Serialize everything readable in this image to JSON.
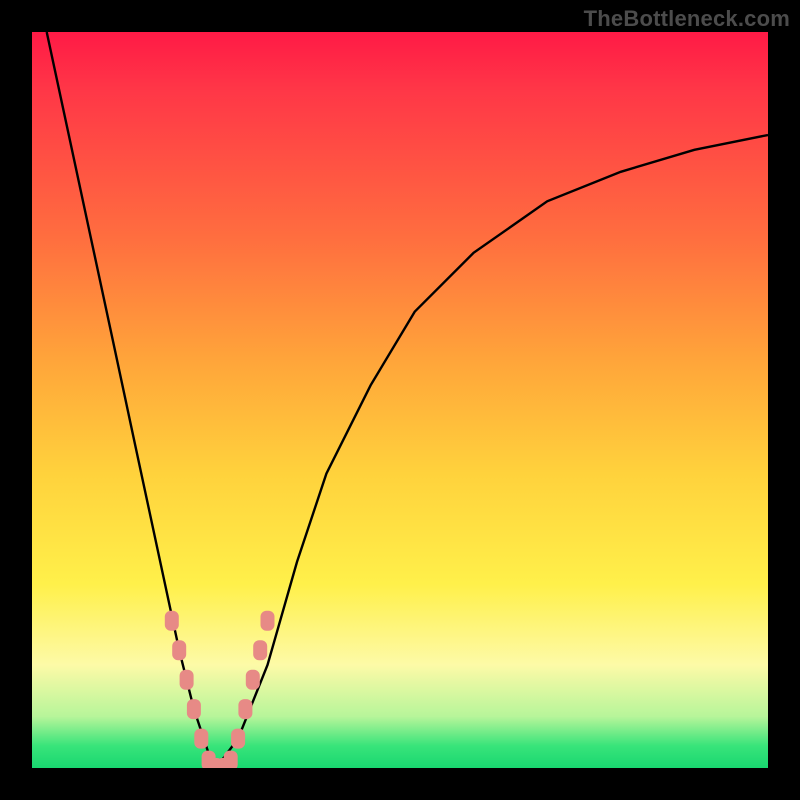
{
  "watermark": "TheBottleneck.com",
  "chart_data": {
    "type": "line",
    "title": "",
    "xlabel": "",
    "ylabel": "",
    "xlim": [
      0,
      100
    ],
    "ylim": [
      0,
      100
    ],
    "legend": false,
    "grid": false,
    "annotations": [],
    "series": [
      {
        "name": "bottleneck-curve",
        "color": "#000000",
        "x": [
          2,
          5,
          8,
          11,
          14,
          17,
          20,
          22,
          24,
          25,
          28,
          32,
          36,
          40,
          46,
          52,
          60,
          70,
          80,
          90,
          100
        ],
        "y": [
          100,
          86,
          72,
          58,
          44,
          30,
          16,
          8,
          2,
          0,
          4,
          14,
          28,
          40,
          52,
          62,
          70,
          77,
          81,
          84,
          86
        ]
      }
    ],
    "markers": [
      {
        "name": "curve-markers",
        "color": "#e78a86",
        "shape": "rounded-rect",
        "points": [
          {
            "x": 19,
            "y": 20
          },
          {
            "x": 20,
            "y": 16
          },
          {
            "x": 21,
            "y": 12
          },
          {
            "x": 22,
            "y": 8
          },
          {
            "x": 23,
            "y": 4
          },
          {
            "x": 24,
            "y": 1
          },
          {
            "x": 25,
            "y": 0
          },
          {
            "x": 26,
            "y": 0
          },
          {
            "x": 27,
            "y": 1
          },
          {
            "x": 28,
            "y": 4
          },
          {
            "x": 29,
            "y": 8
          },
          {
            "x": 30,
            "y": 12
          },
          {
            "x": 31,
            "y": 16
          },
          {
            "x": 32,
            "y": 20
          }
        ]
      }
    ]
  }
}
